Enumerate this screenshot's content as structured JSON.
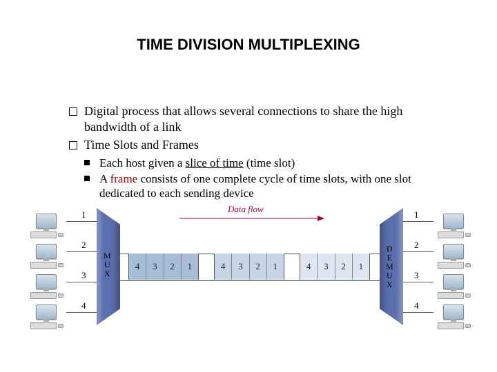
{
  "title": "TIME DIVISION MULTIPLEXING",
  "bullets": {
    "b1a": "Digital process that allows several connections to share the high bandwidth of a link",
    "b1b": "Time Slots and Frames",
    "b2a_pre": "Each host given a ",
    "b2a_u": "slice of time",
    "b2a_post": " (time slot)",
    "b2b_pre": "A ",
    "b2b_red": "frame",
    "b2b_post": " consists of one complete cycle of time slots, with one slot dedicated to each sending device"
  },
  "diagram": {
    "data_flow_label": "Data flow",
    "mux_label": "M\nU\nX",
    "demux_label": "D\nE\nM\nU\nX",
    "left_numbers": [
      "1",
      "2",
      "3",
      "4"
    ],
    "right_numbers": [
      "1",
      "2",
      "3",
      "4"
    ],
    "frame_cells": [
      "4",
      "3",
      "2",
      "1"
    ]
  }
}
